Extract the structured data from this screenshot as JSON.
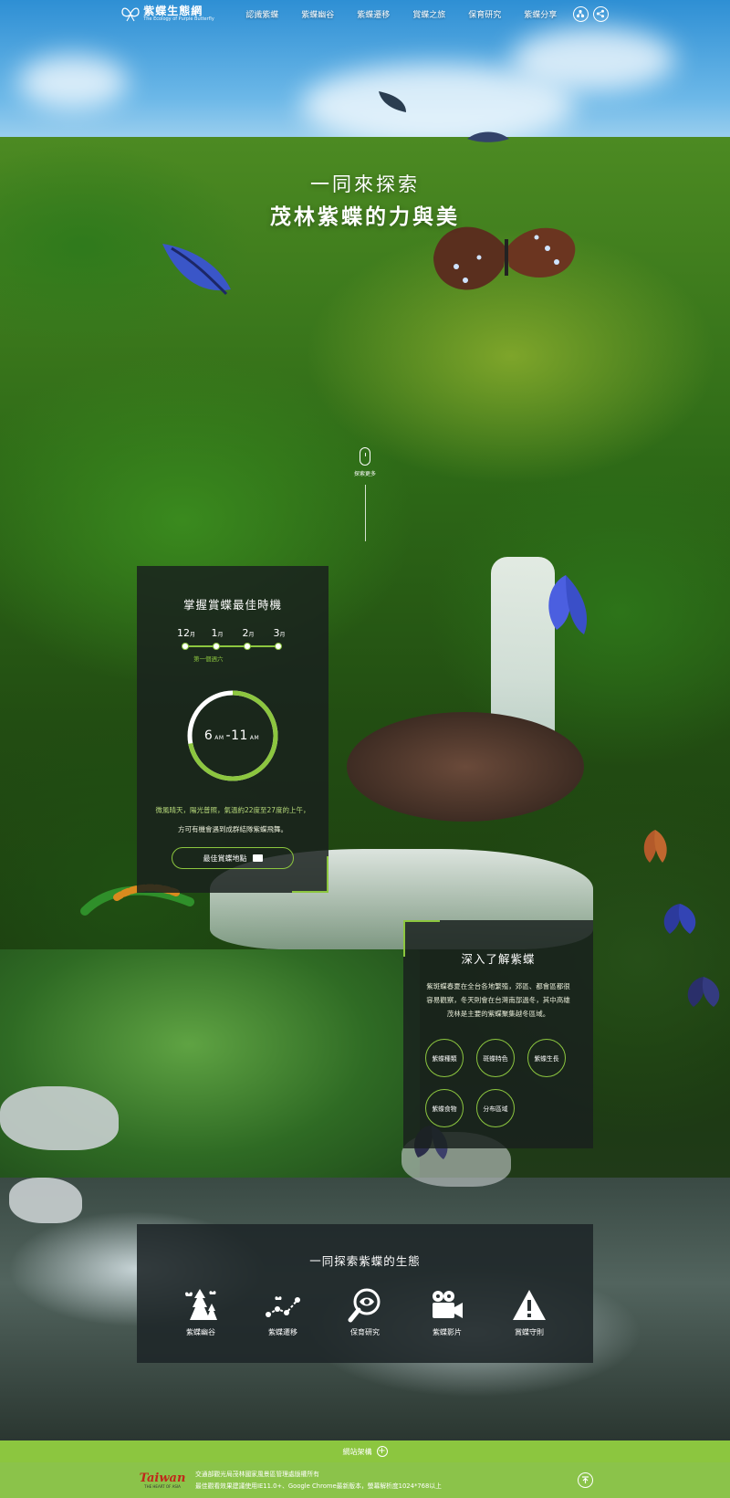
{
  "header": {
    "logo": {
      "main": "紫蝶生態網",
      "sub": "The Ecology of Purple Butterfly"
    },
    "nav": [
      "認識紫蝶",
      "紫蝶幽谷",
      "紫蝶遷移",
      "賞蝶之旅",
      "保育研究",
      "紫蝶分享"
    ],
    "icons": [
      "sitemap-icon",
      "share-icon"
    ]
  },
  "hero": {
    "line1": "一同來探索",
    "line2": "茂林紫蝶的力與美",
    "scroll_text": "探索更多"
  },
  "best_time": {
    "title": "掌握賞蝶最佳時機",
    "months": [
      {
        "num": "12",
        "unit": "月"
      },
      {
        "num": "1",
        "unit": "月"
      },
      {
        "num": "2",
        "unit": "月"
      },
      {
        "num": "3",
        "unit": "月"
      }
    ],
    "week_label": "第一個週六",
    "time_start": "6",
    "time_start_unit": "AM",
    "time_sep": "-",
    "time_end": "11",
    "time_end_unit": "AM",
    "progress_fraction": 0.72,
    "desc1": "微風晴天，陽光普照，氣溫約22度至27度的上午，",
    "desc2": "方可有機會遇到成群結隊紫蝶飛舞。",
    "button_label": "最佳賞蝶地點",
    "accent_color": "#8cc63f"
  },
  "know": {
    "title": "深入了解紫蝶",
    "desc": "紫斑蝶春夏在全台各地繁殖，郊區、都會區都很容易觀察，冬天則會在台灣南部過冬，其中高雄茂林是主要的紫蝶聚集越冬區域。",
    "buttons": [
      "紫蝶種類",
      "斑蝶特色",
      "紫蝶生長",
      "紫蝶食物",
      "分布區域"
    ]
  },
  "explore": {
    "title": "一同探索紫蝶的生態",
    "items": [
      {
        "label": "紫蝶幽谷",
        "icon": "forest-butterfly-icon"
      },
      {
        "label": "紫蝶遷移",
        "icon": "migration-route-icon"
      },
      {
        "label": "保育研究",
        "icon": "magnifier-eye-icon"
      },
      {
        "label": "紫蝶影片",
        "icon": "video-camera-icon"
      },
      {
        "label": "賞蝶守則",
        "icon": "warning-icon"
      }
    ]
  },
  "footer": {
    "sitemap": "網站架構",
    "taiwan_word": "Taiwan",
    "taiwan_sub": "THE HEART OF ASIA",
    "line1": "交通部觀光局茂林國家風景區管理處版權所有",
    "line2": "最佳觀看效果建議使用IE11.0+、Google Chrome最新版本，螢幕解析度1024*768以上"
  }
}
